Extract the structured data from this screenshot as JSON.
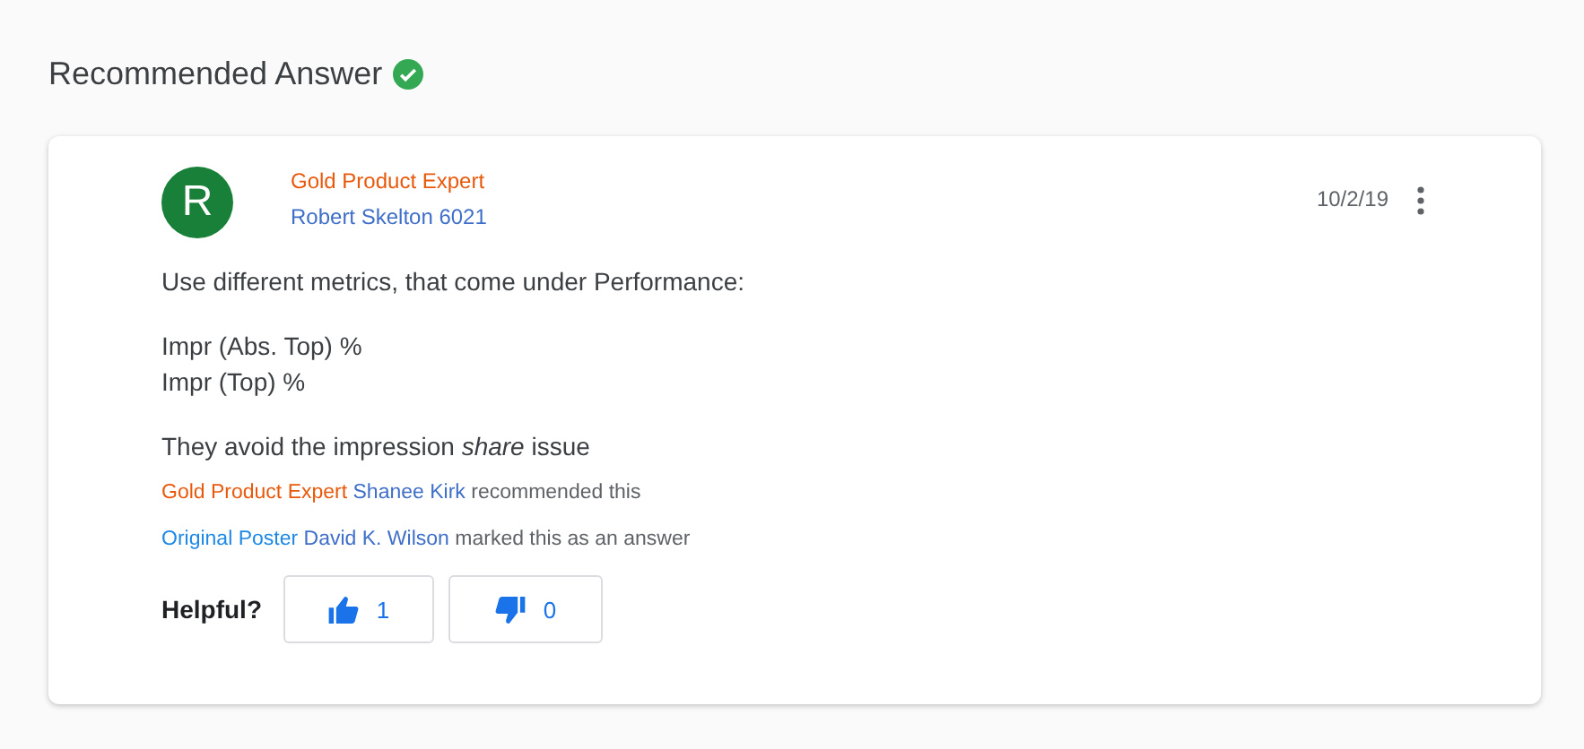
{
  "heading": {
    "title": "Recommended Answer"
  },
  "answer": {
    "avatar_letter": "R",
    "badge": "Gold Product Expert",
    "author": "Robert Skelton 6021",
    "date": "10/2/19",
    "body": [
      "Use different metrics, that come under Performance:",
      "Impr (Abs. Top) %\nImpr (Top) %",
      "They avoid the impression *share* issue"
    ],
    "credits": [
      {
        "badge": "Gold Product Expert",
        "kind": "gold",
        "name": "Shanee Kirk",
        "action": "recommended this"
      },
      {
        "badge": "Original Poster",
        "kind": "poster",
        "name": "David K. Wilson",
        "action": "marked this as an answer"
      }
    ],
    "helpful": {
      "label": "Helpful?",
      "up_count": "1",
      "down_count": "0"
    }
  }
}
